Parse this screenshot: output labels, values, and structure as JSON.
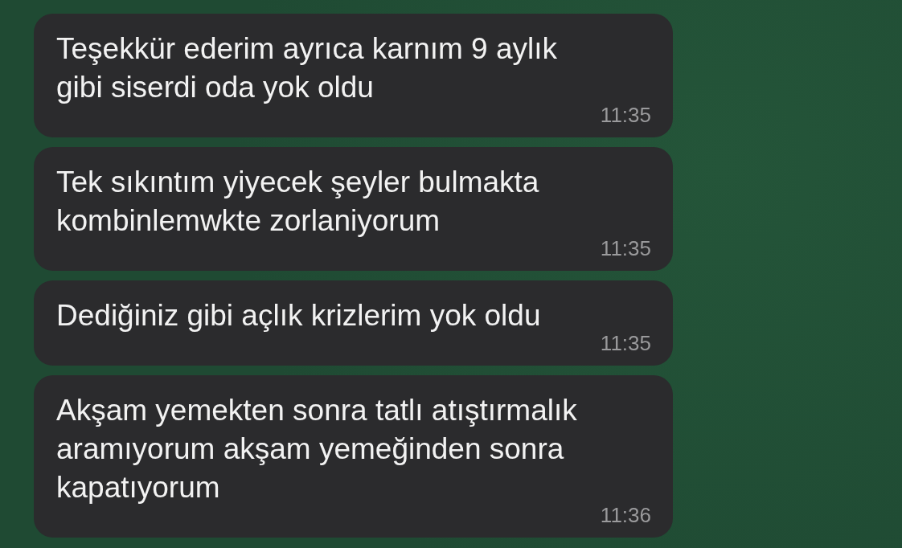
{
  "messages": [
    {
      "text": "Teşekkür ederim ayrıca karnım 9 aylık\ngibi siserdi oda yok oldu",
      "time": "11:35"
    },
    {
      "text": "Tek sıkıntım yiyecek şeyler bulmakta\nkombinlemwkte zorlaniyorum",
      "time": "11:35"
    },
    {
      "text": "Dediğiniz gibi açlık krizlerim yok oldu",
      "time": "11:35"
    },
    {
      "text": "Akşam yemekten sonra tatlı atıştırmalık\naramıyorum akşam yemeğinden sonra\nkapatıyorum",
      "time": "11:36"
    }
  ]
}
